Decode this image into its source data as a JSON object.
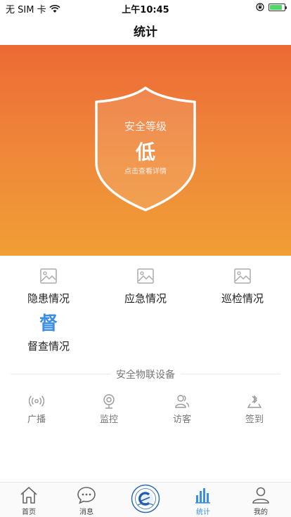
{
  "status_bar": {
    "carrier": "无 SIM 卡",
    "time": "上午10:45",
    "battery_level": 0.85
  },
  "nav": {
    "title": "统计"
  },
  "hero": {
    "label": "安全等级",
    "level": "低",
    "hint": "点击查看详情"
  },
  "menu": {
    "items": [
      {
        "label": "隐患情况",
        "icon": "image-placeholder-icon"
      },
      {
        "label": "应急情况",
        "icon": "image-placeholder-icon"
      },
      {
        "label": "巡检情况",
        "icon": "image-placeholder-icon"
      },
      {
        "label": "督查情况",
        "icon_glyph": "督"
      }
    ]
  },
  "iot": {
    "title": "安全物联设备",
    "items": [
      {
        "label": "广播",
        "icon": "broadcast-icon"
      },
      {
        "label": "监控",
        "icon": "camera-icon"
      },
      {
        "label": "访客",
        "icon": "visitor-icon"
      },
      {
        "label": "签到",
        "icon": "checkin-icon"
      }
    ]
  },
  "tabs": {
    "items": [
      {
        "label": "首页",
        "icon": "home-icon"
      },
      {
        "label": "消息",
        "icon": "message-icon"
      },
      {
        "label": "",
        "icon": "app-logo-icon"
      },
      {
        "label": "统计",
        "icon": "bar-chart-icon",
        "active": true
      },
      {
        "label": "我的",
        "icon": "user-icon"
      }
    ]
  },
  "colors": {
    "hero_top": "#ec6a35",
    "hero_bottom": "#f09e36",
    "accent": "#3b8ee6",
    "battery": "#4cd964"
  }
}
